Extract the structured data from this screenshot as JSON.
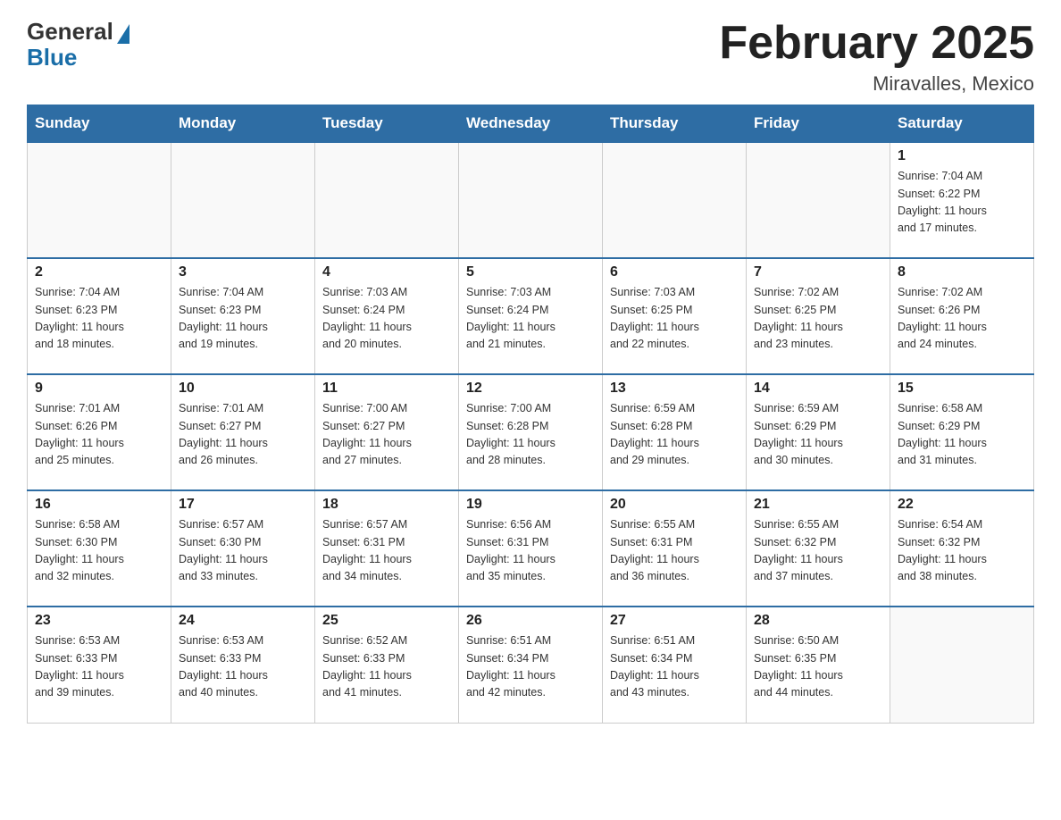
{
  "header": {
    "logo_general": "General",
    "logo_blue": "Blue",
    "month_title": "February 2025",
    "location": "Miravalles, Mexico"
  },
  "days_of_week": [
    "Sunday",
    "Monday",
    "Tuesday",
    "Wednesday",
    "Thursday",
    "Friday",
    "Saturday"
  ],
  "weeks": [
    [
      {
        "day": "",
        "info": ""
      },
      {
        "day": "",
        "info": ""
      },
      {
        "day": "",
        "info": ""
      },
      {
        "day": "",
        "info": ""
      },
      {
        "day": "",
        "info": ""
      },
      {
        "day": "",
        "info": ""
      },
      {
        "day": "1",
        "info": "Sunrise: 7:04 AM\nSunset: 6:22 PM\nDaylight: 11 hours\nand 17 minutes."
      }
    ],
    [
      {
        "day": "2",
        "info": "Sunrise: 7:04 AM\nSunset: 6:23 PM\nDaylight: 11 hours\nand 18 minutes."
      },
      {
        "day": "3",
        "info": "Sunrise: 7:04 AM\nSunset: 6:23 PM\nDaylight: 11 hours\nand 19 minutes."
      },
      {
        "day": "4",
        "info": "Sunrise: 7:03 AM\nSunset: 6:24 PM\nDaylight: 11 hours\nand 20 minutes."
      },
      {
        "day": "5",
        "info": "Sunrise: 7:03 AM\nSunset: 6:24 PM\nDaylight: 11 hours\nand 21 minutes."
      },
      {
        "day": "6",
        "info": "Sunrise: 7:03 AM\nSunset: 6:25 PM\nDaylight: 11 hours\nand 22 minutes."
      },
      {
        "day": "7",
        "info": "Sunrise: 7:02 AM\nSunset: 6:25 PM\nDaylight: 11 hours\nand 23 minutes."
      },
      {
        "day": "8",
        "info": "Sunrise: 7:02 AM\nSunset: 6:26 PM\nDaylight: 11 hours\nand 24 minutes."
      }
    ],
    [
      {
        "day": "9",
        "info": "Sunrise: 7:01 AM\nSunset: 6:26 PM\nDaylight: 11 hours\nand 25 minutes."
      },
      {
        "day": "10",
        "info": "Sunrise: 7:01 AM\nSunset: 6:27 PM\nDaylight: 11 hours\nand 26 minutes."
      },
      {
        "day": "11",
        "info": "Sunrise: 7:00 AM\nSunset: 6:27 PM\nDaylight: 11 hours\nand 27 minutes."
      },
      {
        "day": "12",
        "info": "Sunrise: 7:00 AM\nSunset: 6:28 PM\nDaylight: 11 hours\nand 28 minutes."
      },
      {
        "day": "13",
        "info": "Sunrise: 6:59 AM\nSunset: 6:28 PM\nDaylight: 11 hours\nand 29 minutes."
      },
      {
        "day": "14",
        "info": "Sunrise: 6:59 AM\nSunset: 6:29 PM\nDaylight: 11 hours\nand 30 minutes."
      },
      {
        "day": "15",
        "info": "Sunrise: 6:58 AM\nSunset: 6:29 PM\nDaylight: 11 hours\nand 31 minutes."
      }
    ],
    [
      {
        "day": "16",
        "info": "Sunrise: 6:58 AM\nSunset: 6:30 PM\nDaylight: 11 hours\nand 32 minutes."
      },
      {
        "day": "17",
        "info": "Sunrise: 6:57 AM\nSunset: 6:30 PM\nDaylight: 11 hours\nand 33 minutes."
      },
      {
        "day": "18",
        "info": "Sunrise: 6:57 AM\nSunset: 6:31 PM\nDaylight: 11 hours\nand 34 minutes."
      },
      {
        "day": "19",
        "info": "Sunrise: 6:56 AM\nSunset: 6:31 PM\nDaylight: 11 hours\nand 35 minutes."
      },
      {
        "day": "20",
        "info": "Sunrise: 6:55 AM\nSunset: 6:31 PM\nDaylight: 11 hours\nand 36 minutes."
      },
      {
        "day": "21",
        "info": "Sunrise: 6:55 AM\nSunset: 6:32 PM\nDaylight: 11 hours\nand 37 minutes."
      },
      {
        "day": "22",
        "info": "Sunrise: 6:54 AM\nSunset: 6:32 PM\nDaylight: 11 hours\nand 38 minutes."
      }
    ],
    [
      {
        "day": "23",
        "info": "Sunrise: 6:53 AM\nSunset: 6:33 PM\nDaylight: 11 hours\nand 39 minutes."
      },
      {
        "day": "24",
        "info": "Sunrise: 6:53 AM\nSunset: 6:33 PM\nDaylight: 11 hours\nand 40 minutes."
      },
      {
        "day": "25",
        "info": "Sunrise: 6:52 AM\nSunset: 6:33 PM\nDaylight: 11 hours\nand 41 minutes."
      },
      {
        "day": "26",
        "info": "Sunrise: 6:51 AM\nSunset: 6:34 PM\nDaylight: 11 hours\nand 42 minutes."
      },
      {
        "day": "27",
        "info": "Sunrise: 6:51 AM\nSunset: 6:34 PM\nDaylight: 11 hours\nand 43 minutes."
      },
      {
        "day": "28",
        "info": "Sunrise: 6:50 AM\nSunset: 6:35 PM\nDaylight: 11 hours\nand 44 minutes."
      },
      {
        "day": "",
        "info": ""
      }
    ]
  ]
}
